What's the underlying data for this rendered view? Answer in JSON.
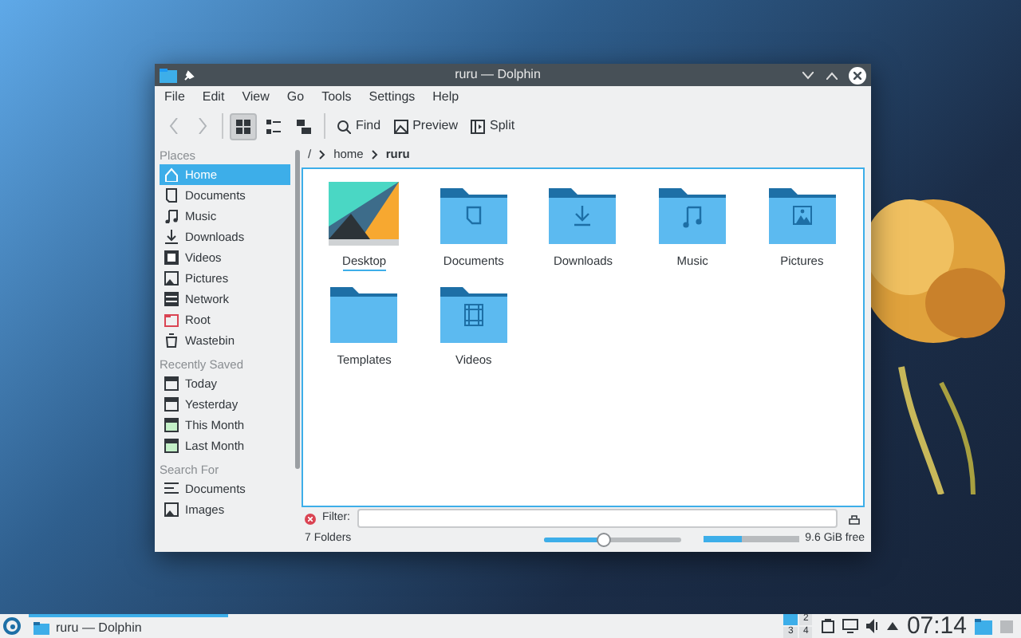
{
  "window": {
    "title": "ruru — Dolphin"
  },
  "menu": [
    "File",
    "Edit",
    "View",
    "Go",
    "Tools",
    "Settings",
    "Help"
  ],
  "toolbar": {
    "nav": [
      {
        "kind": "back",
        "disabled": true
      },
      {
        "kind": "forward",
        "disabled": true
      }
    ],
    "view_modes": [
      {
        "kind": "icons",
        "selected": true
      },
      {
        "kind": "compact",
        "selected": false
      },
      {
        "kind": "details",
        "selected": false
      }
    ],
    "actions": [
      {
        "kind": "find",
        "label": "Find"
      },
      {
        "kind": "preview",
        "label": "Preview"
      },
      {
        "kind": "split",
        "label": "Split"
      }
    ]
  },
  "breadcrumb": [
    "/",
    "home",
    "ruru"
  ],
  "sidebar": [
    {
      "heading": "Places",
      "items": [
        {
          "kind": "home",
          "label": "Home",
          "selected": true
        },
        {
          "kind": "documents",
          "label": "Documents",
          "selected": false
        },
        {
          "kind": "music",
          "label": "Music",
          "selected": false
        },
        {
          "kind": "downloads",
          "label": "Downloads",
          "selected": false
        },
        {
          "kind": "videos",
          "label": "Videos",
          "selected": false
        },
        {
          "kind": "pictures",
          "label": "Pictures",
          "selected": false
        },
        {
          "kind": "network",
          "label": "Network",
          "selected": false
        },
        {
          "kind": "root",
          "label": "Root",
          "selected": false
        },
        {
          "kind": "trash",
          "label": "Wastebin",
          "selected": false
        }
      ]
    },
    {
      "heading": "Recently Saved",
      "items": [
        {
          "kind": "calendar",
          "label": "Today",
          "selected": false
        },
        {
          "kind": "calendar",
          "label": "Yesterday",
          "selected": false
        },
        {
          "kind": "calendar-green",
          "label": "This Month",
          "selected": false
        },
        {
          "kind": "calendar-green",
          "label": "Last Month",
          "selected": false
        }
      ]
    },
    {
      "heading": "Search For",
      "items": [
        {
          "kind": "text",
          "label": "Documents",
          "selected": false
        },
        {
          "kind": "pictures",
          "label": "Images",
          "selected": false
        }
      ]
    }
  ],
  "files": [
    {
      "kind": "image",
      "name": "Desktop",
      "focused": true
    },
    {
      "kind": "documents",
      "name": "Documents",
      "focused": false
    },
    {
      "kind": "downloads",
      "name": "Downloads",
      "focused": false
    },
    {
      "kind": "music",
      "name": "Music",
      "focused": false
    },
    {
      "kind": "pictures",
      "name": "Pictures",
      "focused": false
    },
    {
      "kind": "plain",
      "name": "Templates",
      "focused": false
    },
    {
      "kind": "videos",
      "name": "Videos",
      "focused": false
    }
  ],
  "filter": {
    "label": "Filter:"
  },
  "status": {
    "count": "7 Folders",
    "zoom": {
      "level": 0.43
    },
    "space": {
      "level": 0.4
    },
    "free": "9.6 GiB free"
  },
  "taskbar": {
    "task": "ruru — Dolphin",
    "pager": [
      {
        "selected": true
      },
      {
        "label": "2",
        "selected": false
      },
      {
        "label": "3",
        "selected": false
      },
      {
        "label": "4",
        "selected": false
      }
    ],
    "clock": "07:14"
  }
}
